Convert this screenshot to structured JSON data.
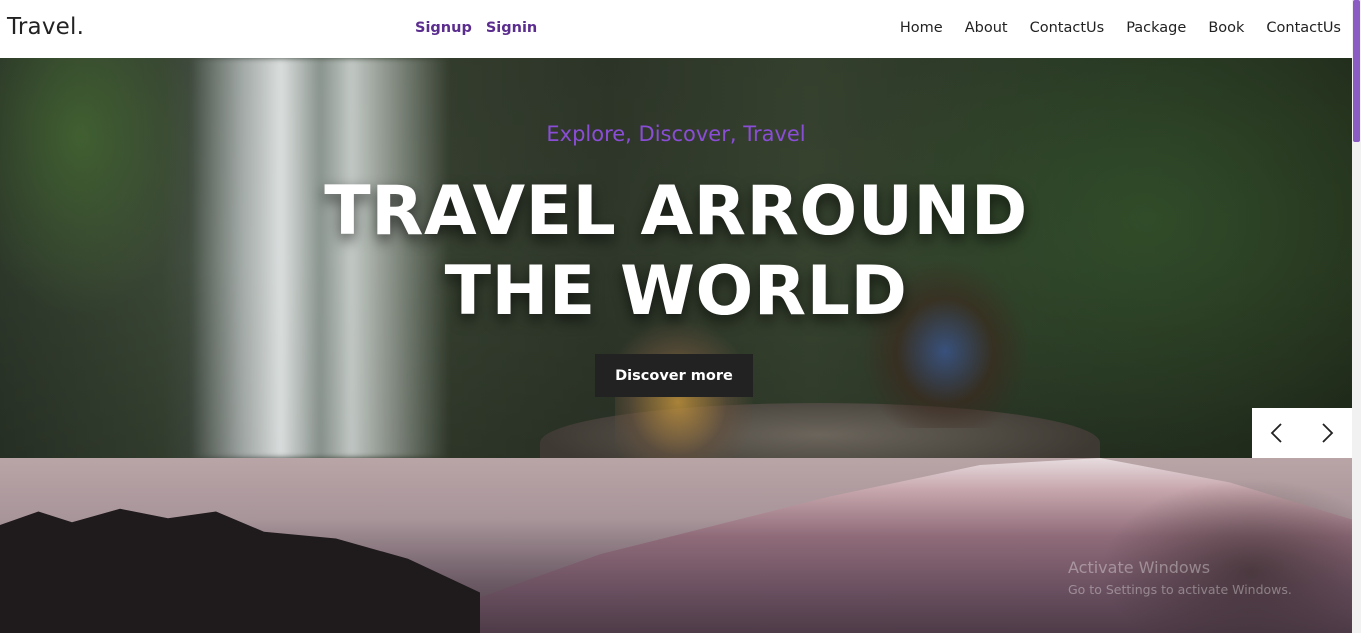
{
  "header": {
    "logo": "Travel.",
    "auth": [
      "Signup",
      "Signin"
    ],
    "nav": [
      "Home",
      "About",
      "ContactUs",
      "Package",
      "Book",
      "ContactUs"
    ]
  },
  "hero": {
    "tagline": "Explore, Discover, Travel",
    "title_line1": "TRAVEL ARROUND",
    "title_line2": "THE WORLD",
    "button": "Discover more"
  },
  "slider": {
    "prev_icon": "chevron-left-icon",
    "next_icon": "chevron-right-icon"
  },
  "watermark": {
    "line1": "Activate Windows",
    "line2": "Go to Settings to activate Windows."
  },
  "colors": {
    "accent": "#8a4dd6",
    "auth_link": "#5b2d8f",
    "button_bg": "#222222",
    "scroll_thumb": "#8b5cc4"
  }
}
